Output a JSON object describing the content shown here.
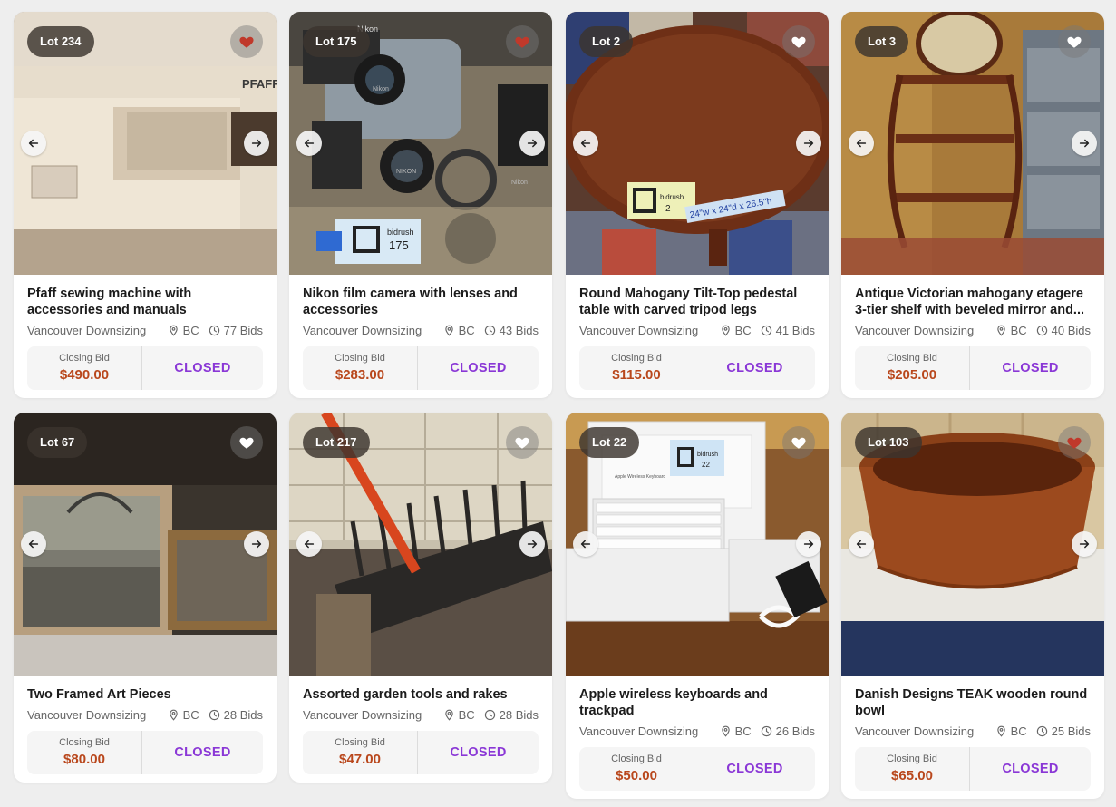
{
  "lots": [
    {
      "lot": "Lot 234",
      "title": "Pfaff sewing machine with accessories and manuals",
      "seller": "Vancouver Downsizing",
      "location": "BC",
      "bids": "77 Bids",
      "closing_label": "Closing Bid",
      "closing_value": "$490.00",
      "status": "CLOSED",
      "favorited": true
    },
    {
      "lot": "Lot 175",
      "title": "Nikon film camera with lenses and accessories",
      "seller": "Vancouver Downsizing",
      "location": "BC",
      "bids": "43 Bids",
      "closing_label": "Closing Bid",
      "closing_value": "$283.00",
      "status": "CLOSED",
      "favorited": true
    },
    {
      "lot": "Lot 2",
      "title": "Round Mahogany Tilt-Top pedestal table with carved tripod legs",
      "seller": "Vancouver Downsizing",
      "location": "BC",
      "bids": "41 Bids",
      "closing_label": "Closing Bid",
      "closing_value": "$115.00",
      "status": "CLOSED",
      "favorited": false
    },
    {
      "lot": "Lot 3",
      "title": "Antique Victorian mahogany etagere 3-tier shelf with beveled mirror and...",
      "seller": "Vancouver Downsizing",
      "location": "BC",
      "bids": "40 Bids",
      "closing_label": "Closing Bid",
      "closing_value": "$205.00",
      "status": "CLOSED",
      "favorited": false
    },
    {
      "lot": "Lot 67",
      "title": "Two Framed Art Pieces",
      "seller": "Vancouver Downsizing",
      "location": "BC",
      "bids": "28 Bids",
      "closing_label": "Closing Bid",
      "closing_value": "$80.00",
      "status": "CLOSED",
      "favorited": false
    },
    {
      "lot": "Lot 217",
      "title": "Assorted garden tools and rakes",
      "seller": "Vancouver Downsizing",
      "location": "BC",
      "bids": "28 Bids",
      "closing_label": "Closing Bid",
      "closing_value": "$47.00",
      "status": "CLOSED",
      "favorited": false
    },
    {
      "lot": "Lot 22",
      "title": "Apple wireless keyboards and trackpad",
      "seller": "Vancouver Downsizing",
      "location": "BC",
      "bids": "26 Bids",
      "closing_label": "Closing Bid",
      "closing_value": "$50.00",
      "status": "CLOSED",
      "favorited": false
    },
    {
      "lot": "Lot 103",
      "title": "Danish Designs TEAK wooden round bowl",
      "seller": "Vancouver Downsizing",
      "location": "BC",
      "bids": "25 Bids",
      "closing_label": "Closing Bid",
      "closing_value": "$65.00",
      "status": "CLOSED",
      "favorited": true
    }
  ],
  "icons": {
    "favorite": "heart-icon",
    "previous": "arrow-left-icon",
    "next": "arrow-right-icon",
    "location": "map-pin-icon",
    "bids": "clock-icon"
  },
  "colors": {
    "closing_value": "#b9471c",
    "status": "#8a37d6",
    "favorited_heart": "#c0392b",
    "unfavorited_heart": "#ffffff"
  },
  "photo_text": {
    "lot_234": [
      "PFAFF"
    ],
    "lot_175": [
      "Nikon",
      "bidrush",
      "175",
      "Nikon",
      "NIKON",
      "Nikon"
    ],
    "lot_2": [
      "bidrush",
      "2",
      "24\"w x 24\"d x 26.5\"h"
    ],
    "lot_22": [
      "bidrush",
      "22",
      "Apple Wireless Keyboard"
    ]
  }
}
